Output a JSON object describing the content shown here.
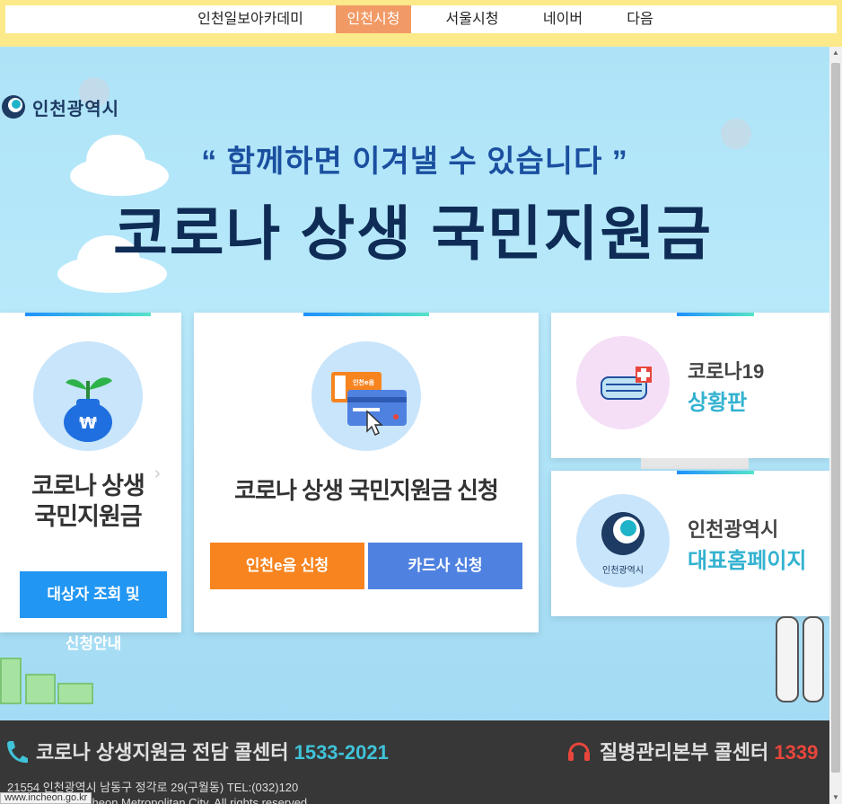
{
  "bookmarks": [
    {
      "label": "인천일보아카데미"
    },
    {
      "label": "인천시청"
    },
    {
      "label": "서울시청"
    },
    {
      "label": "네이버"
    },
    {
      "label": "다음"
    }
  ],
  "hero": {
    "logo": "인천광역시",
    "subtitle": "“ 함께하면 이겨낼 수 있습니다 ”",
    "title": "코로나 상생 국민지원금"
  },
  "card_left": {
    "title_line1": "코로나 상생",
    "title_line2": "국민지원금",
    "button": "대상자 조회 및",
    "button_overflow": "신청안내"
  },
  "card_center": {
    "title": "코로나 상생 국민지원금 신청",
    "card_small_label": "인천e음",
    "btn_left": "인천e음 신청",
    "btn_right": "카드사 신청"
  },
  "card_right_top": {
    "line1": "코로나19",
    "line2": "상황판"
  },
  "card_right_bottom": {
    "line1": "인천광역시",
    "line2": "대표홈페이지",
    "emblem_label": "인천광역시"
  },
  "footer": {
    "call1_label": "코로나 상생지원금 전담 콜센터",
    "call1_num": "1533-2021",
    "call2_label": "질병관리본부 콜센터",
    "call2_num": "1339",
    "address": "21554 인천광역시 남동구 정각로 29(구월동) TEL:(032)120",
    "copyright": "cheon Metropolitan City. All rights reserved."
  },
  "status_url": "www.incheon.go.kr",
  "colors": {
    "accent_active_tab": "#f19a66",
    "btn_blue": "#2196f3",
    "btn_orange": "#f7841f",
    "btn_indigo": "#4f82e0",
    "teal": "#33b2d0"
  },
  "icons": [
    "coin-bag-sprout-icon",
    "card-pointer-icon",
    "mask-plus-icon",
    "incheon-emblem-icon",
    "phone-icon",
    "headset-icon",
    "virus-icon",
    "chevron-right-icon"
  ]
}
